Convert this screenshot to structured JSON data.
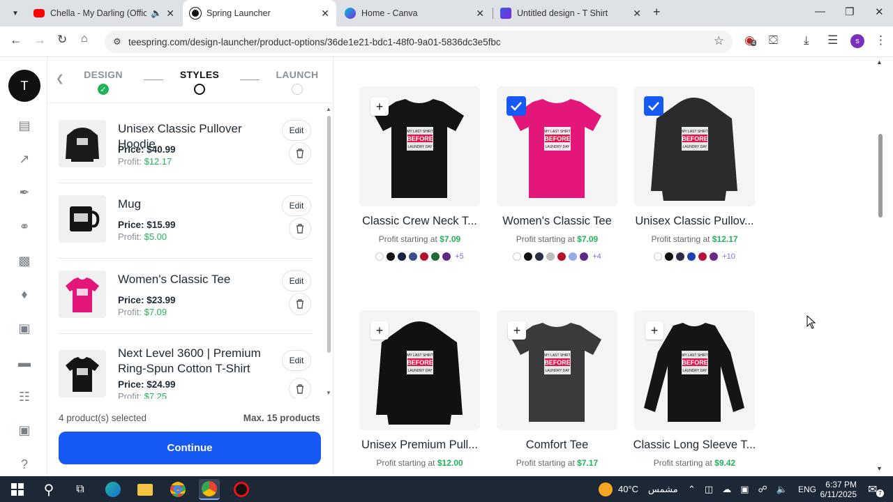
{
  "browser": {
    "tabs": [
      {
        "title": "Chella - My Darling (Officia",
        "icon": "youtube-icon",
        "active": false
      },
      {
        "title": "Spring Launcher",
        "icon": "spring-icon",
        "active": true
      },
      {
        "title": "Home - Canva",
        "icon": "canva-icon",
        "active": false
      },
      {
        "title": "Untitled design - T Shirt",
        "icon": "canva-design-icon",
        "active": false
      }
    ],
    "url": "teespring.com/design-launcher/product-options/36de1e21-bdc1-48f0-9a01-5836dc3e5fbc",
    "extension_badge": "4",
    "profile_initial": "s"
  },
  "rail": {
    "avatar_initial": "T"
  },
  "steps": [
    {
      "label": "DESIGN",
      "state": "done"
    },
    {
      "label": "STYLES",
      "state": "current"
    },
    {
      "label": "LAUNCH",
      "state": "pending"
    }
  ],
  "selected_products": [
    {
      "name": "Unisex Classic Pullover Hoodie",
      "price": "Price: $40.99",
      "profit_label": "Profit:",
      "profit": "$12.17",
      "edit": "Edit"
    },
    {
      "name": "Mug",
      "price": "Price: $15.99",
      "profit_label": "Profit:",
      "profit": "$5.00",
      "edit": "Edit"
    },
    {
      "name": "Women's Classic Tee",
      "price": "Price: $23.99",
      "profit_label": "Profit:",
      "profit": "$7.09",
      "edit": "Edit"
    },
    {
      "name": "Next Level 3600 | Premium Ring-Spun Cotton T-Shirt",
      "price": "Price: $24.99",
      "profit_label": "Profit:",
      "profit": "$7.25",
      "edit": "Edit"
    }
  ],
  "footer": {
    "count": "4 product(s) selected",
    "max": "Max. 15 products",
    "continue": "Continue"
  },
  "catalog": [
    {
      "title": "Classic Crew Neck T...",
      "profit_prefix": "Profit starting at",
      "profit": "$7.09",
      "selected": false,
      "garment": "tee",
      "color": "#141414",
      "swatches": [
        "#ffffff",
        "#111111",
        "#1c2340",
        "#3c4f8f",
        "#b3122a",
        "#1f6b36",
        "#5b2a86"
      ],
      "more": "+5"
    },
    {
      "title": "Women's Classic Tee",
      "profit_prefix": "Profit starting at",
      "profit": "$7.09",
      "selected": true,
      "garment": "tee",
      "color": "#e3177a",
      "swatches": [
        "#ffffff",
        "#111111",
        "#2a2f45",
        "#bdbdbd",
        "#b3122a",
        "#9aa9e8",
        "#5b2a86"
      ],
      "more": "+4"
    },
    {
      "title": "Unisex Classic Pullov...",
      "profit_prefix": "Profit starting at",
      "profit": "$12.17",
      "selected": true,
      "garment": "hoodie",
      "color": "#2b2b2d",
      "swatches": [
        "#ffffff",
        "#111111",
        "#2a2f45",
        "#1f3fb0",
        "#b3123f",
        "#6b2a86"
      ],
      "more": "+10"
    },
    {
      "title": "Unisex Premium Pull...",
      "profit_prefix": "Profit starting at",
      "profit": "$12.00",
      "selected": false,
      "garment": "hoodie",
      "color": "#111112",
      "swatches": [],
      "more": ""
    },
    {
      "title": "Comfort Tee",
      "profit_prefix": "Profit starting at",
      "profit": "$7.17",
      "selected": false,
      "garment": "tee",
      "color": "#3a3a3c",
      "swatches": [],
      "more": ""
    },
    {
      "title": "Classic Long Sleeve T...",
      "profit_prefix": "Profit starting at",
      "profit": "$9.42",
      "selected": false,
      "garment": "longsleeve",
      "color": "#151515",
      "swatches": [],
      "more": ""
    }
  ],
  "design_text": {
    "line1": "MY LAST SHIRT",
    "line2": "BEFORE",
    "line3": "LAUNDRY DAY"
  },
  "taskbar": {
    "temperature": "40°C",
    "weather": "مشمس",
    "lang": "ENG",
    "time": "6:37 PM",
    "date": "6/11/2025",
    "notif_count": "7"
  },
  "colors": {
    "accent": "#1659f5",
    "profit": "#21b35a"
  }
}
